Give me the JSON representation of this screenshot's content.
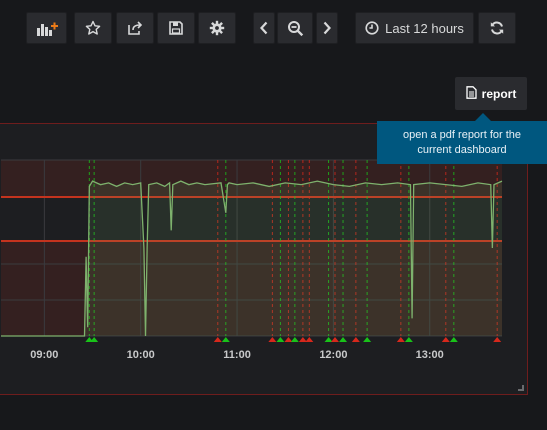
{
  "toolbar": {
    "time_range_label": "Last 12 hours",
    "buttons": [
      {
        "name": "add-panel",
        "icon": "bar-chart-plus-icon"
      },
      {
        "name": "star",
        "icon": "star-icon"
      },
      {
        "name": "share",
        "icon": "share-icon"
      },
      {
        "name": "save",
        "icon": "save-icon"
      },
      {
        "name": "settings",
        "icon": "gear-icon"
      },
      {
        "name": "shift-back",
        "icon": "chevron-left-icon"
      },
      {
        "name": "zoom-out",
        "icon": "zoom-out-icon"
      },
      {
        "name": "shift-forward",
        "icon": "chevron-right-icon"
      },
      {
        "name": "time-picker",
        "icon": "clock-icon"
      },
      {
        "name": "refresh",
        "icon": "refresh-icon"
      }
    ]
  },
  "report": {
    "button_label": "report",
    "icon": "document-icon",
    "tooltip": "open a pdf report for the current dashboard"
  },
  "colors": {
    "series": "#7eb26d",
    "threshold": "#c4331e",
    "alert_ok": "#19c219",
    "alert_fire": "#d6281c",
    "tooltip_bg": "#00577f"
  },
  "chart_data": {
    "type": "line",
    "x_ticks": [
      "09:00",
      "10:00",
      "11:00",
      "12:00",
      "13:00"
    ],
    "grid": true,
    "thresholds": [
      "upper",
      "lower"
    ],
    "series": [
      {
        "x": [
          "08:33",
          "09:00",
          "09:25",
          "09:26",
          "09:27",
          "09:28",
          "09:30",
          "09:35",
          "09:40",
          "09:45",
          "09:50",
          "09:55",
          "10:00",
          "10:02",
          "10:03",
          "10:04",
          "10:05",
          "10:10",
          "10:15",
          "10:18",
          "10:19",
          "10:20",
          "10:25",
          "10:30",
          "10:35",
          "10:40",
          "10:50",
          "10:53",
          "10:54",
          "10:55",
          "11:00",
          "11:10",
          "11:20",
          "11:30",
          "11:40",
          "11:50",
          "12:00",
          "12:10",
          "12:20",
          "12:30",
          "12:40",
          "12:48",
          "12:49",
          "12:50",
          "13:00",
          "13:10",
          "13:20",
          "13:30",
          "13:38",
          "13:39",
          "13:40",
          "13:45"
        ],
        "values": [
          0,
          0,
          0,
          0.45,
          0.05,
          0.85,
          0.88,
          0.86,
          0.87,
          0.85,
          0.87,
          0.86,
          0.87,
          0.5,
          0,
          0.5,
          0.86,
          0.87,
          0.85,
          0.87,
          0.6,
          0.86,
          0.88,
          0.86,
          0.87,
          0.86,
          0.87,
          0.7,
          0.86,
          0.87,
          0.86,
          0.87,
          0.85,
          0.87,
          0.86,
          0.88,
          0.86,
          0.85,
          0.87,
          0.86,
          0.87,
          0.86,
          0.1,
          0.86,
          0.87,
          0.86,
          0.85,
          0.87,
          0.86,
          0.5,
          0.86,
          0.88
        ]
      }
    ],
    "alert_events": [
      {
        "time": "09:28",
        "state": "ok"
      },
      {
        "time": "09:31",
        "state": "ok"
      },
      {
        "time": "10:48",
        "state": "alerting"
      },
      {
        "time": "10:53",
        "state": "ok"
      },
      {
        "time": "11:22",
        "state": "alerting"
      },
      {
        "time": "11:27",
        "state": "ok"
      },
      {
        "time": "11:32",
        "state": "alerting"
      },
      {
        "time": "11:36",
        "state": "ok"
      },
      {
        "time": "11:41",
        "state": "alerting"
      },
      {
        "time": "11:45",
        "state": "alerting"
      },
      {
        "time": "11:57",
        "state": "ok"
      },
      {
        "time": "12:01",
        "state": "alerting"
      },
      {
        "time": "12:06",
        "state": "ok"
      },
      {
        "time": "12:14",
        "state": "alerting"
      },
      {
        "time": "12:21",
        "state": "ok"
      },
      {
        "time": "12:42",
        "state": "alerting"
      },
      {
        "time": "12:47",
        "state": "ok"
      },
      {
        "time": "13:10",
        "state": "alerting"
      },
      {
        "time": "13:15",
        "state": "ok"
      },
      {
        "time": "13:42",
        "state": "alerting"
      }
    ]
  }
}
